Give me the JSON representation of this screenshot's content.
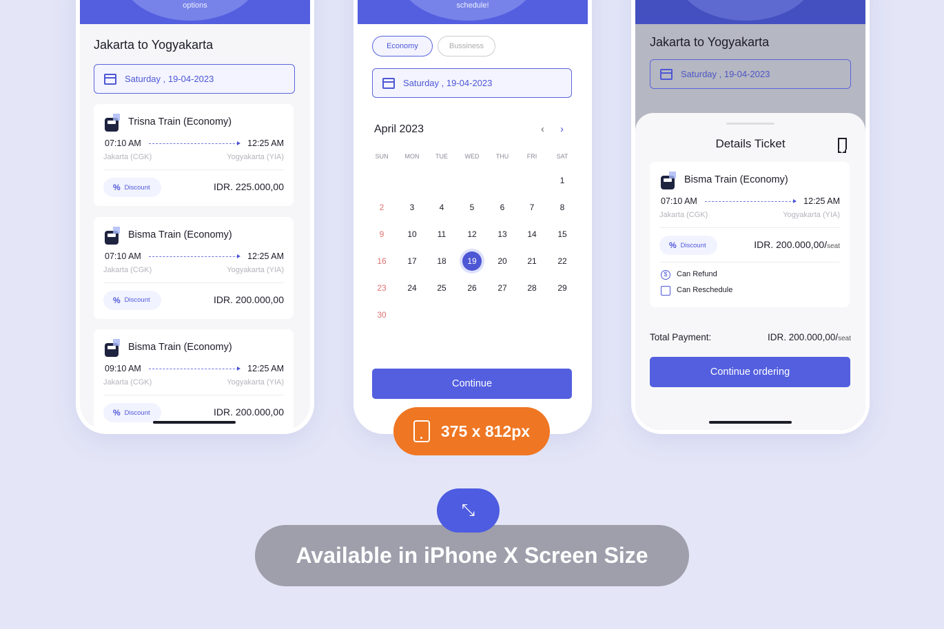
{
  "colors": {
    "primary": "#535fdf",
    "orange": "#ef7622",
    "gray_pill": "#9e9fab",
    "background": "#e4e6f7"
  },
  "left": {
    "header_caption": "options",
    "title": "Jakarta to Yogyakarta",
    "date": "Saturday , 19-04-2023",
    "tickets": [
      {
        "name": "Trisna Train (Economy)",
        "depart": "07:10 AM",
        "arrive": "12:25 AM",
        "from": "Jakarta (CGK)",
        "to": "Yogyakarta (YIA)",
        "discount": "Discount",
        "price": "IDR. 225.000,00"
      },
      {
        "name": "Bisma Train (Economy)",
        "depart": "07:10 AM",
        "arrive": "12:25 AM",
        "from": "Jakarta (CGK)",
        "to": "Yogyakarta (YIA)",
        "discount": "Discount",
        "price": "IDR. 200.000,00"
      },
      {
        "name": "Bisma Train (Economy)",
        "depart": "09:10 AM",
        "arrive": "12:25 AM",
        "from": "Jakarta (CGK)",
        "to": "Yogyakarta (YIA)",
        "discount": "Discount",
        "price": "IDR. 200.000,00"
      }
    ]
  },
  "middle": {
    "header_caption": "schedule!",
    "class_options": [
      "Economy",
      "Bussiness"
    ],
    "selected_class": "Economy",
    "date": "Saturday , 19-04-2023",
    "calendar": {
      "month": "April 2023",
      "weekdays": [
        "SUN",
        "MON",
        "TUE",
        "WED",
        "THU",
        "FRI",
        "SAT"
      ],
      "first_weekday": 6,
      "days_in_month": 30,
      "selected_day": 19,
      "prev_icon": "chevron-left-icon",
      "next_icon": "chevron-right-icon"
    },
    "continue": "Continue"
  },
  "right": {
    "title": "Jakarta to Yogyakarta",
    "date": "Saturday , 19-04-2023",
    "sheet_title": "Details Ticket",
    "ticket": {
      "name": "Bisma Train (Economy)",
      "depart": "07:10 AM",
      "arrive": "12:25 AM",
      "from": "Jakarta (CGK)",
      "to": "Yogyakarta (YIA)",
      "discount": "Discount",
      "price": "IDR. 200.000,00/",
      "unit": "seat"
    },
    "features": [
      "Can Refund",
      "Can Reschedule"
    ],
    "total_label": "Total Payment:",
    "total_price": "IDR. 200.000,00/",
    "total_unit": "seat",
    "continue": "Continue ordering"
  },
  "badge": {
    "size": "375 x 812px"
  },
  "banner": {
    "text": "Available in iPhone X Screen Size"
  }
}
